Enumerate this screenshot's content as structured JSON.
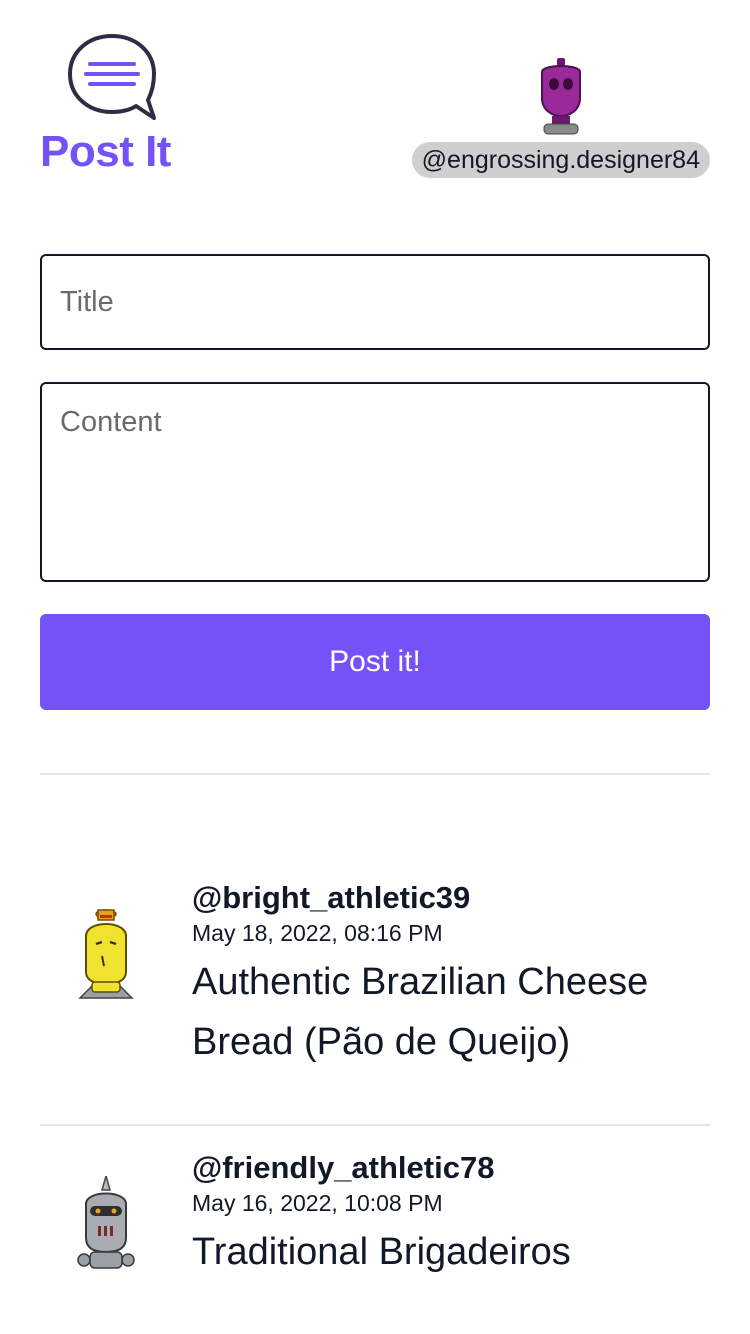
{
  "header": {
    "brand_name": "Post It",
    "user_handle": "@engrossing.designer84"
  },
  "form": {
    "title_placeholder": "Title",
    "content_placeholder": "Content",
    "submit_label": "Post it!"
  },
  "posts": [
    {
      "author": "@bright_athletic39",
      "date": "May 18, 2022, 08:16 PM",
      "title": "Authentic Brazilian Cheese Bread (Pão de Queijo)"
    },
    {
      "author": "@friendly_athletic78",
      "date": "May 16, 2022, 10:08 PM",
      "title": "Traditional Brigadeiros"
    }
  ],
  "colors": {
    "accent": "#7551f8",
    "text": "#111827",
    "handle_bg": "#cfcfcf",
    "divider": "#e5e5e5"
  },
  "icons": {
    "logo": "speech-bubble-icon",
    "user_avatar": "purple-robot-avatar",
    "post_1_avatar": "yellow-robot-avatar",
    "post_2_avatar": "gray-robot-avatar"
  }
}
